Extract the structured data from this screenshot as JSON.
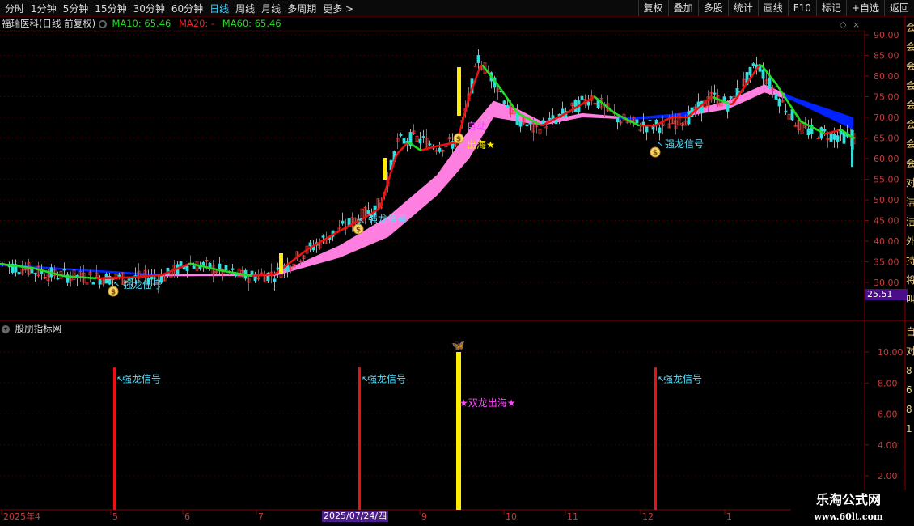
{
  "toolbar": {
    "periods": [
      "分时",
      "1分钟",
      "5分钟",
      "15分钟",
      "30分钟",
      "60分钟",
      "日线",
      "周线",
      "月线",
      "多周期",
      "更多 >"
    ],
    "active_period": "日线",
    "actions": [
      "复权",
      "叠加",
      "多股",
      "统计",
      "画线",
      "F10",
      "标记",
      "+自选",
      "返回"
    ]
  },
  "main_chart": {
    "stock_title": "福瑞医科(日线 前复权)",
    "ma_labels": [
      "MA10: 65.46",
      "MA20: -",
      "MA60: 65.46"
    ],
    "ma_colors": [
      "#22dd22",
      "#ee2222",
      "#22dd22"
    ],
    "y_ticks": [
      "90.00",
      "85.00",
      "80.00",
      "75.00",
      "70.00",
      "65.00",
      "60.00",
      "55.00",
      "50.00",
      "45.00",
      "40.00",
      "35.00",
      "30.00"
    ],
    "current_price_tag": "25.51",
    "signals": {
      "strong_dragon": "强龙信号",
      "auto_label": "自动",
      "double_dragon_short": "出海",
      "star": "★"
    }
  },
  "indicator": {
    "title": "股朋指标网",
    "y_ticks": [
      "10.00",
      "8.00",
      "6.00",
      "4.00",
      "2.00"
    ],
    "strong_dragon_label": "强龙信号",
    "double_dragon_label": "★双龙出海★"
  },
  "x_axis": {
    "labels": [
      "2025年4",
      "5",
      "6",
      "7",
      "9",
      "10",
      "11",
      "12",
      "1"
    ],
    "highlight_date": "2025/07/24/四"
  },
  "right_strip": [
    "会",
    "会",
    "会",
    "会",
    "会",
    "会",
    "会",
    "会",
    "对",
    "洁",
    "洁",
    "外",
    "持",
    "将",
    "叫"
  ],
  "right_strip_bottom": [
    "自",
    "对",
    "8",
    "6",
    "8",
    "1"
  ],
  "watermark": {
    "line1": "乐淘公式网",
    "line2": "www.60lt.com"
  },
  "colors": {
    "up": "#ff3333",
    "down": "#33dddd",
    "ma_red": "#ee1111",
    "ma_green": "#22dd22",
    "pink_band": "#ff7fe0",
    "blue_band": "#0022ff",
    "signal_text": "#55e0ff",
    "magenta_text": "#ff44ff"
  }
}
